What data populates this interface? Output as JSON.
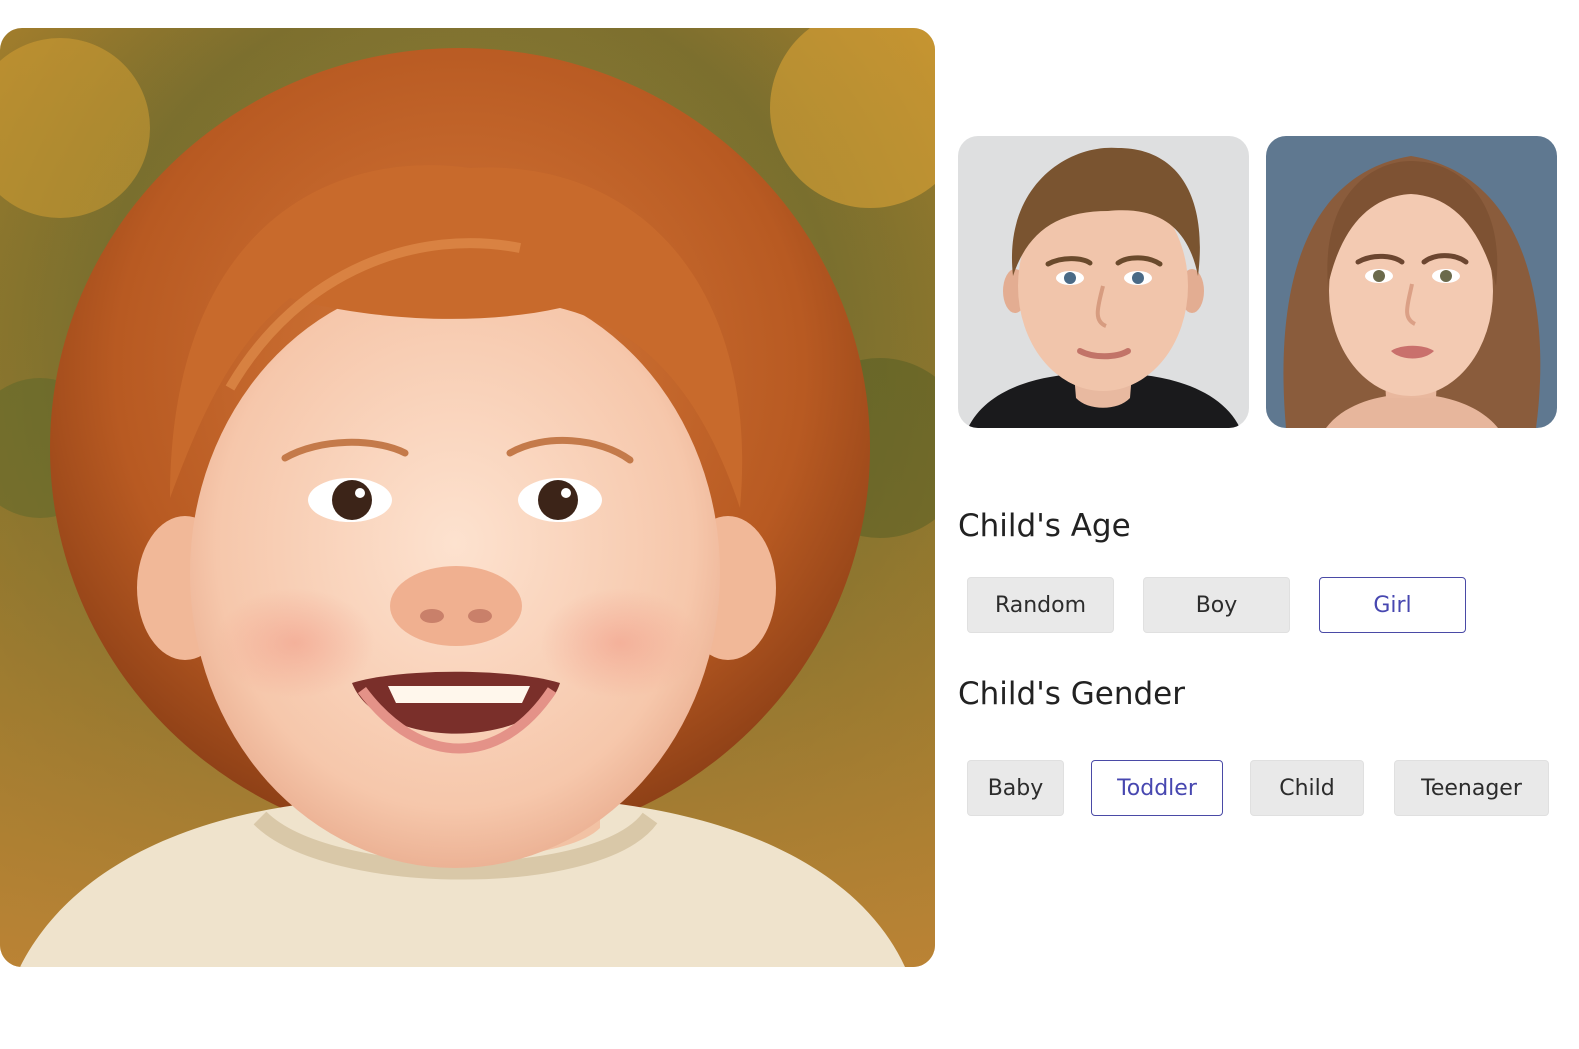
{
  "images": {
    "child_photo": {
      "alt": "Smiling toddler with curly red hair",
      "icon": "child-portrait"
    },
    "father_photo": {
      "alt": "Young man portrait",
      "icon": "male-portrait"
    },
    "mother_photo": {
      "alt": "Young woman portrait",
      "icon": "female-portrait"
    }
  },
  "age_section": {
    "heading": "Child's Age",
    "options": [
      "Random",
      "Boy",
      "Girl"
    ],
    "selected": "Girl"
  },
  "gender_section": {
    "heading": "Child's Gender",
    "options": [
      "Baby",
      "Toddler",
      "Child",
      "Teenager"
    ],
    "selected": "Toddler"
  },
  "colors": {
    "accent": "#4747b0",
    "button_bg": "#e9e9e9",
    "text": "#222222"
  }
}
